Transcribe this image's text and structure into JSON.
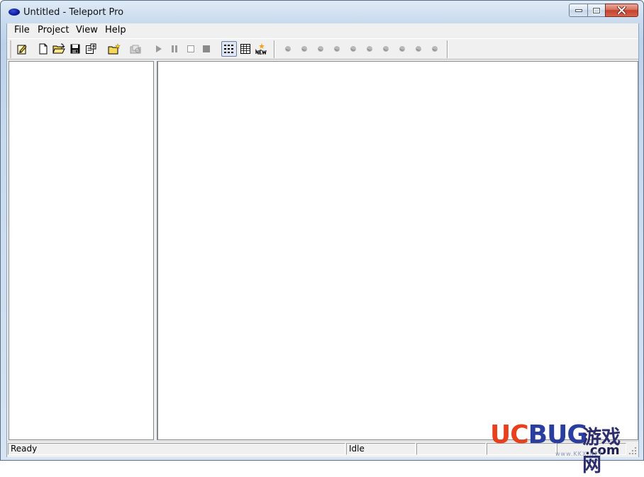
{
  "window": {
    "title": "Untitled - Teleport Pro"
  },
  "menu": {
    "items": [
      "File",
      "Project",
      "View",
      "Help"
    ]
  },
  "toolbar": {
    "buttons": [
      "project-properties-icon",
      "new-document-icon",
      "open-folder-icon",
      "save-icon",
      "properties-icon",
      "new-folder-icon",
      "browse-folder-icon",
      "start-icon",
      "pause-icon",
      "stop-icon",
      "stop-all-icon",
      "tree-view-icon",
      "list-view-icon",
      "new-item-icon"
    ],
    "thread_indicator_count": 10
  },
  "statusbar": {
    "left_text": "Ready",
    "center_text": "Idle"
  },
  "watermark": {
    "brand_uc": "UC",
    "brand_bug": "BUG",
    "chinese": "游戏网",
    "domain": ".com",
    "small": "www.KKX.NET"
  },
  "colors": {
    "titlebar_top": "#dfeaf6",
    "app_icon": "#0b1a9a",
    "close_button": "#c5432d",
    "watermark_uc": "#e8401c",
    "watermark_bug": "#2a3ea0"
  }
}
